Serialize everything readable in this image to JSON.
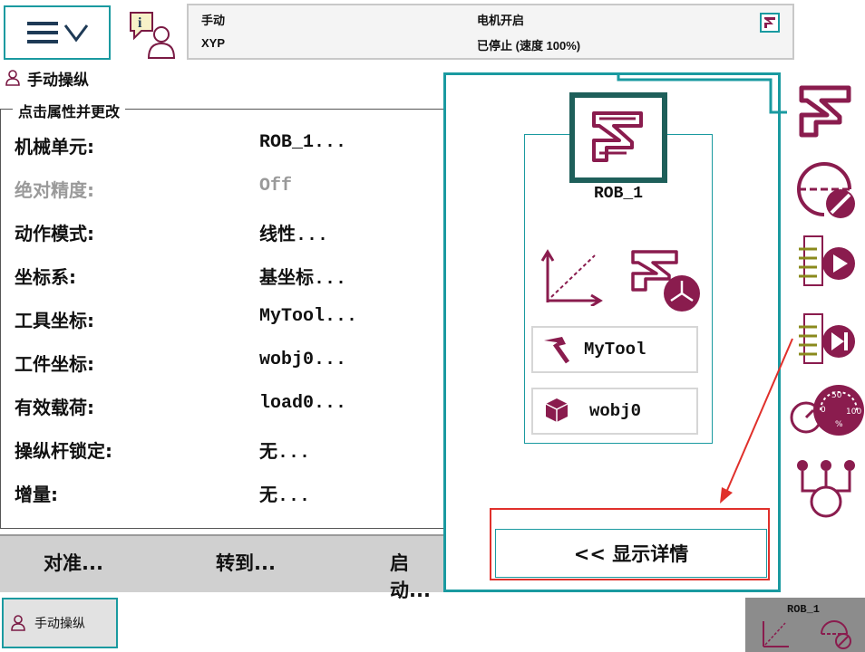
{
  "status": {
    "mode": "手动",
    "task": "XYP",
    "motor": "电机开启",
    "state": "已停止 (速度 100%)"
  },
  "page_title": "手动操纵",
  "properties": {
    "group_title": "点击属性并更改",
    "rows": [
      {
        "label": "机械单元:",
        "value": "ROB_1...",
        "enabled": true
      },
      {
        "label": "绝对精度:",
        "value": "Off",
        "enabled": false
      },
      {
        "label": "动作模式:",
        "value": "线性...",
        "enabled": true
      },
      {
        "label": "坐标系:",
        "value": "基坐标...",
        "enabled": true
      },
      {
        "label": "工具坐标:",
        "value": "MyTool...",
        "enabled": true
      },
      {
        "label": "工件坐标:",
        "value": "wobj0...",
        "enabled": true
      },
      {
        "label": "有效载荷:",
        "value": "load0...",
        "enabled": true
      },
      {
        "label": "操纵杆锁定:",
        "value": "无...",
        "enabled": true
      },
      {
        "label": "增量:",
        "value": "无...",
        "enabled": true
      }
    ]
  },
  "actions": {
    "align": "对准...",
    "goto": "转到...",
    "activate": "启动..."
  },
  "overlay": {
    "mech_unit": "ROB_1",
    "tool": "MyTool",
    "workobject": "wobj0",
    "show_details": "<< 显示详情"
  },
  "taskbar": {
    "jogging": "手动操纵",
    "quickset_unit": "ROB_1"
  },
  "side_icons": [
    "mechanical-unit-icon",
    "increment-off-icon",
    "run-mode-icon",
    "step-mode-icon",
    "speed-icon",
    "tasks-icon"
  ],
  "colors": {
    "accent": "#1a9aa0",
    "robot": "#8a1c4e",
    "highlight": "#e0302b"
  }
}
